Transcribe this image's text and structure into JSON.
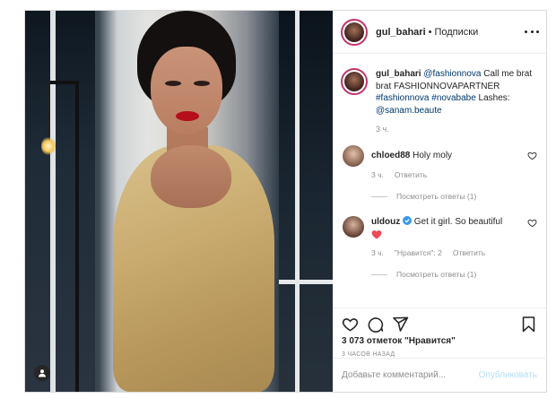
{
  "post": {
    "username": "gul_bahari",
    "dot": "•",
    "follow_status": "Подписки",
    "caption": {
      "username": "gul_bahari",
      "mention1": "@fashionnova",
      "text1": " Call me brat brat FASHIONNOVAPARTNER ",
      "hashtag1": "#fashionnova",
      "hashtag2": "#novababe",
      "text2": " Lashes: ",
      "mention2": "@sanam.beaute",
      "time": "3 ч."
    },
    "comments": [
      {
        "username": "chloed88",
        "text": "Holy moly",
        "time": "3 ч.",
        "reply": "Ответить",
        "view_replies": "Посмотреть ответы (1)"
      },
      {
        "username": "uldouz",
        "text": "Get it girl. So beautiful",
        "time": "3 ч.",
        "likes": "\"Нравится\": 2",
        "reply": "Ответить",
        "view_replies": "Посмотреть ответы (1)"
      }
    ],
    "likes_count": "3 073",
    "likes_suffix": " отметок \"Нравится\"",
    "time_ago": "3 часов назад",
    "add_comment_placeholder": "Добавьте комментарий...",
    "publish_label": "Опубликовать"
  },
  "icons": [
    "user-tag-icon",
    "more-icon",
    "heart-icon",
    "comment-icon",
    "share-icon",
    "save-icon",
    "verified-icon"
  ],
  "colors": {
    "link": "#00376b",
    "muted": "#8e8e8e",
    "border": "#dbdbdb",
    "publish": "#b2dffc",
    "heart": "#ed4956"
  }
}
